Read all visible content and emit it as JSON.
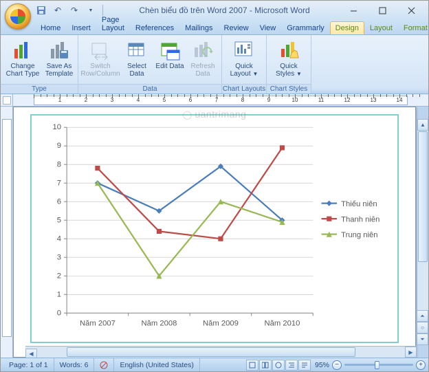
{
  "window": {
    "title": "Chèn biểu đồ trên Word 2007 - Microsoft Word"
  },
  "qat": [
    "save-icon",
    "undo-icon",
    "redo-icon"
  ],
  "tabs": [
    {
      "id": "home",
      "label": "Home"
    },
    {
      "id": "insert",
      "label": "Insert"
    },
    {
      "id": "pagelayout",
      "label": "Page Layout"
    },
    {
      "id": "references",
      "label": "References"
    },
    {
      "id": "mailings",
      "label": "Mailings"
    },
    {
      "id": "review",
      "label": "Review"
    },
    {
      "id": "view",
      "label": "View"
    },
    {
      "id": "grammarly",
      "label": "Grammarly"
    },
    {
      "id": "design",
      "label": "Design",
      "active": true,
      "context": true
    },
    {
      "id": "layout",
      "label": "Layout",
      "context": true
    },
    {
      "id": "format",
      "label": "Format",
      "context": true
    }
  ],
  "ribbon": {
    "groups": [
      {
        "id": "type",
        "label": "Type",
        "buttons": [
          {
            "id": "change-chart-type",
            "label": "Change Chart Type"
          },
          {
            "id": "save-as-template",
            "label": "Save As Template"
          }
        ]
      },
      {
        "id": "data",
        "label": "Data",
        "buttons": [
          {
            "id": "switch-rowcol",
            "label": "Switch Row/Column",
            "disabled": true
          },
          {
            "id": "select-data",
            "label": "Select Data"
          },
          {
            "id": "edit-data",
            "label": "Edit Data"
          },
          {
            "id": "refresh-data",
            "label": "Refresh Data",
            "disabled": true
          }
        ]
      },
      {
        "id": "chartlayouts",
        "label": "Chart Layouts",
        "buttons": [
          {
            "id": "quick-layout",
            "label": "Quick Layout",
            "drop": true
          }
        ]
      },
      {
        "id": "chartstyles",
        "label": "Chart Styles",
        "buttons": [
          {
            "id": "quick-styles",
            "label": "Quick Styles",
            "drop": true
          }
        ]
      }
    ]
  },
  "chart_data": {
    "type": "line",
    "categories": [
      "Năm 2007",
      "Năm 2008",
      "Năm 2009",
      "Năm 2010"
    ],
    "series": [
      {
        "name": "Thiếu niên",
        "color": "#4a7ebb",
        "values": [
          7.0,
          5.5,
          7.9,
          5.0
        ]
      },
      {
        "name": "Thanh niên",
        "color": "#be4b48",
        "values": [
          7.8,
          4.4,
          4.0,
          8.9
        ]
      },
      {
        "name": "Trung niên",
        "color": "#98b954",
        "values": [
          7.0,
          2.0,
          6.0,
          4.9
        ]
      }
    ],
    "ylabel": "",
    "xlabel": "",
    "ylim": [
      0,
      10
    ],
    "yticks": [
      0,
      1,
      2,
      3,
      4,
      5,
      6,
      7,
      8,
      9,
      10
    ]
  },
  "status": {
    "page": "Page: 1 of 1",
    "words": "Words: 6",
    "language": "English (United States)",
    "zoom": "95%"
  },
  "watermark": "uantrimang"
}
